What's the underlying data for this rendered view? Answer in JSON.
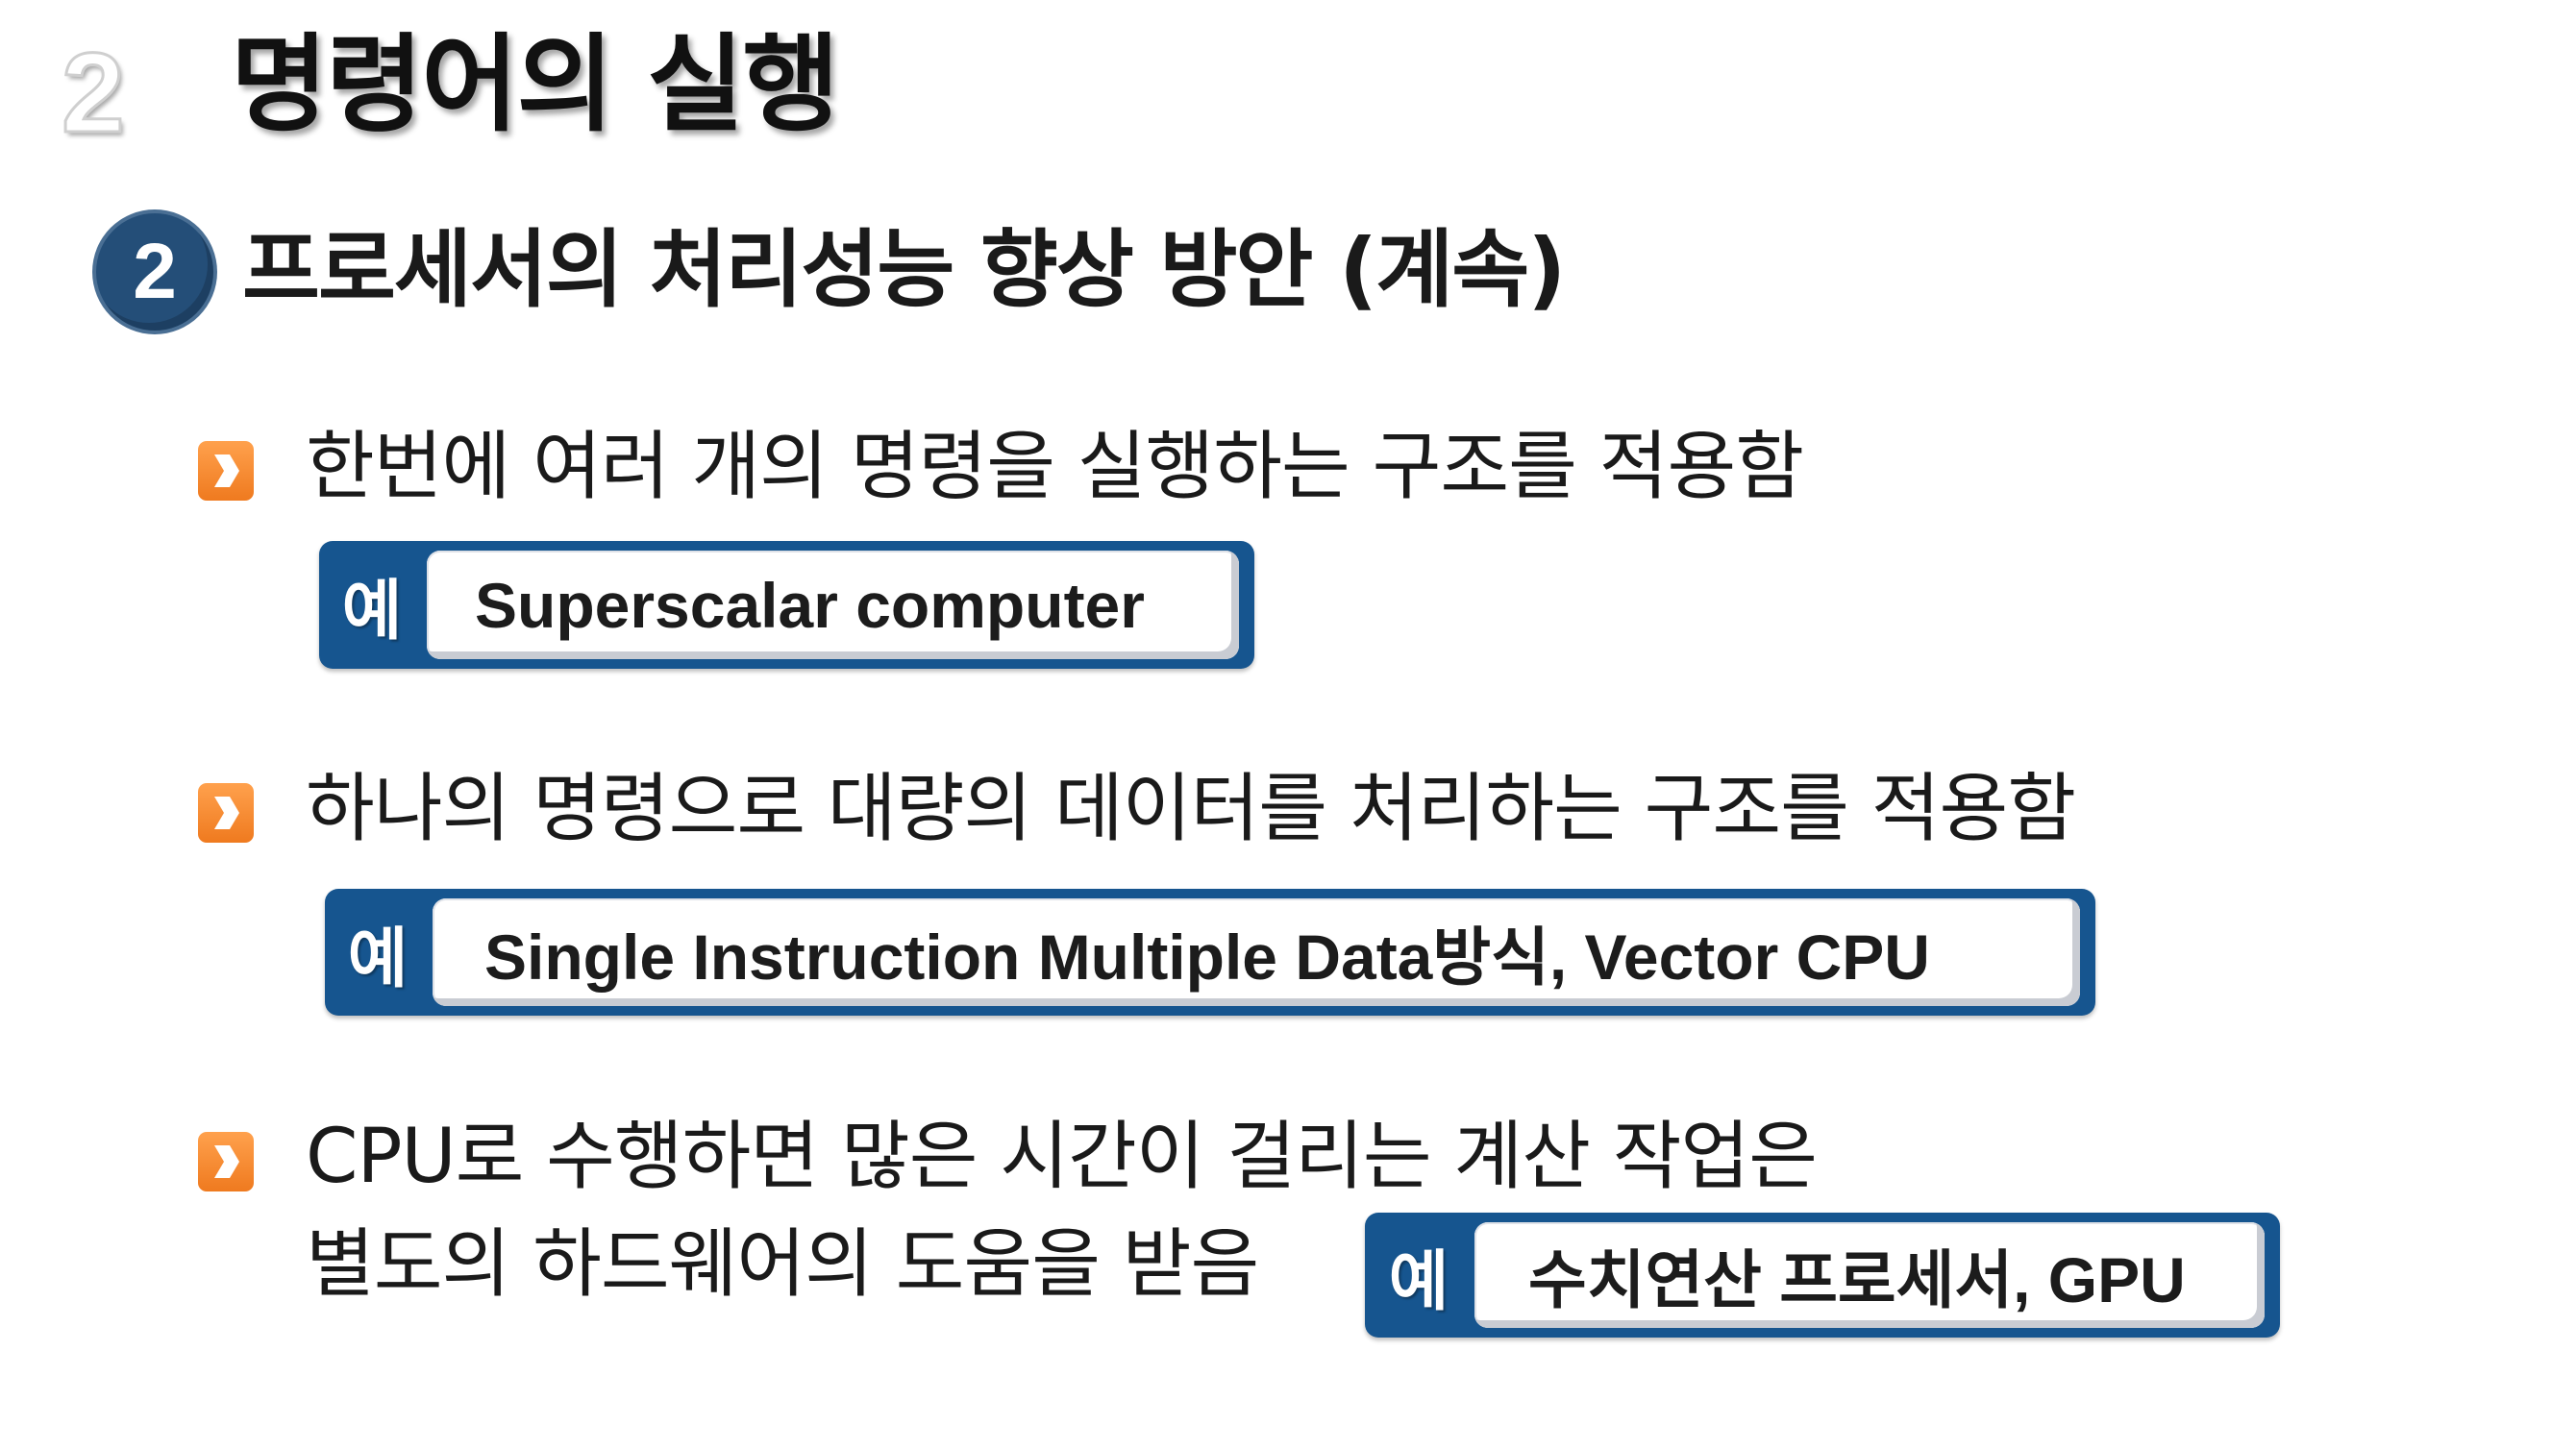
{
  "chapter": {
    "number": "2",
    "title": "명령어의 실행"
  },
  "section": {
    "number": "2",
    "title": "프로세서의 처리성능 향상 방안 (계속)"
  },
  "example_tag": "예",
  "bullets": [
    {
      "text": "한번에 여러 개의 명령을 실행하는 구조를 적용함",
      "example": "Superscalar computer"
    },
    {
      "text": "하나의 명령으로 대량의 데이터를 처리하는 구조를 적용함",
      "example": "Single Instruction Multiple Data방식, Vector CPU"
    },
    {
      "text_line1": "CPU로 수행하면 많은 시간이 걸리는 계산 작업은",
      "text_line2": "별도의 하드웨어의 도움을 받음",
      "example": "수치연산 프로세서, GPU"
    }
  ],
  "colors": {
    "accent_blue": "#16558f",
    "badge_blue": "#244e78",
    "bullet_orange": "#f28a2e"
  },
  "icons": {
    "bullet": "chevron-right-icon"
  }
}
